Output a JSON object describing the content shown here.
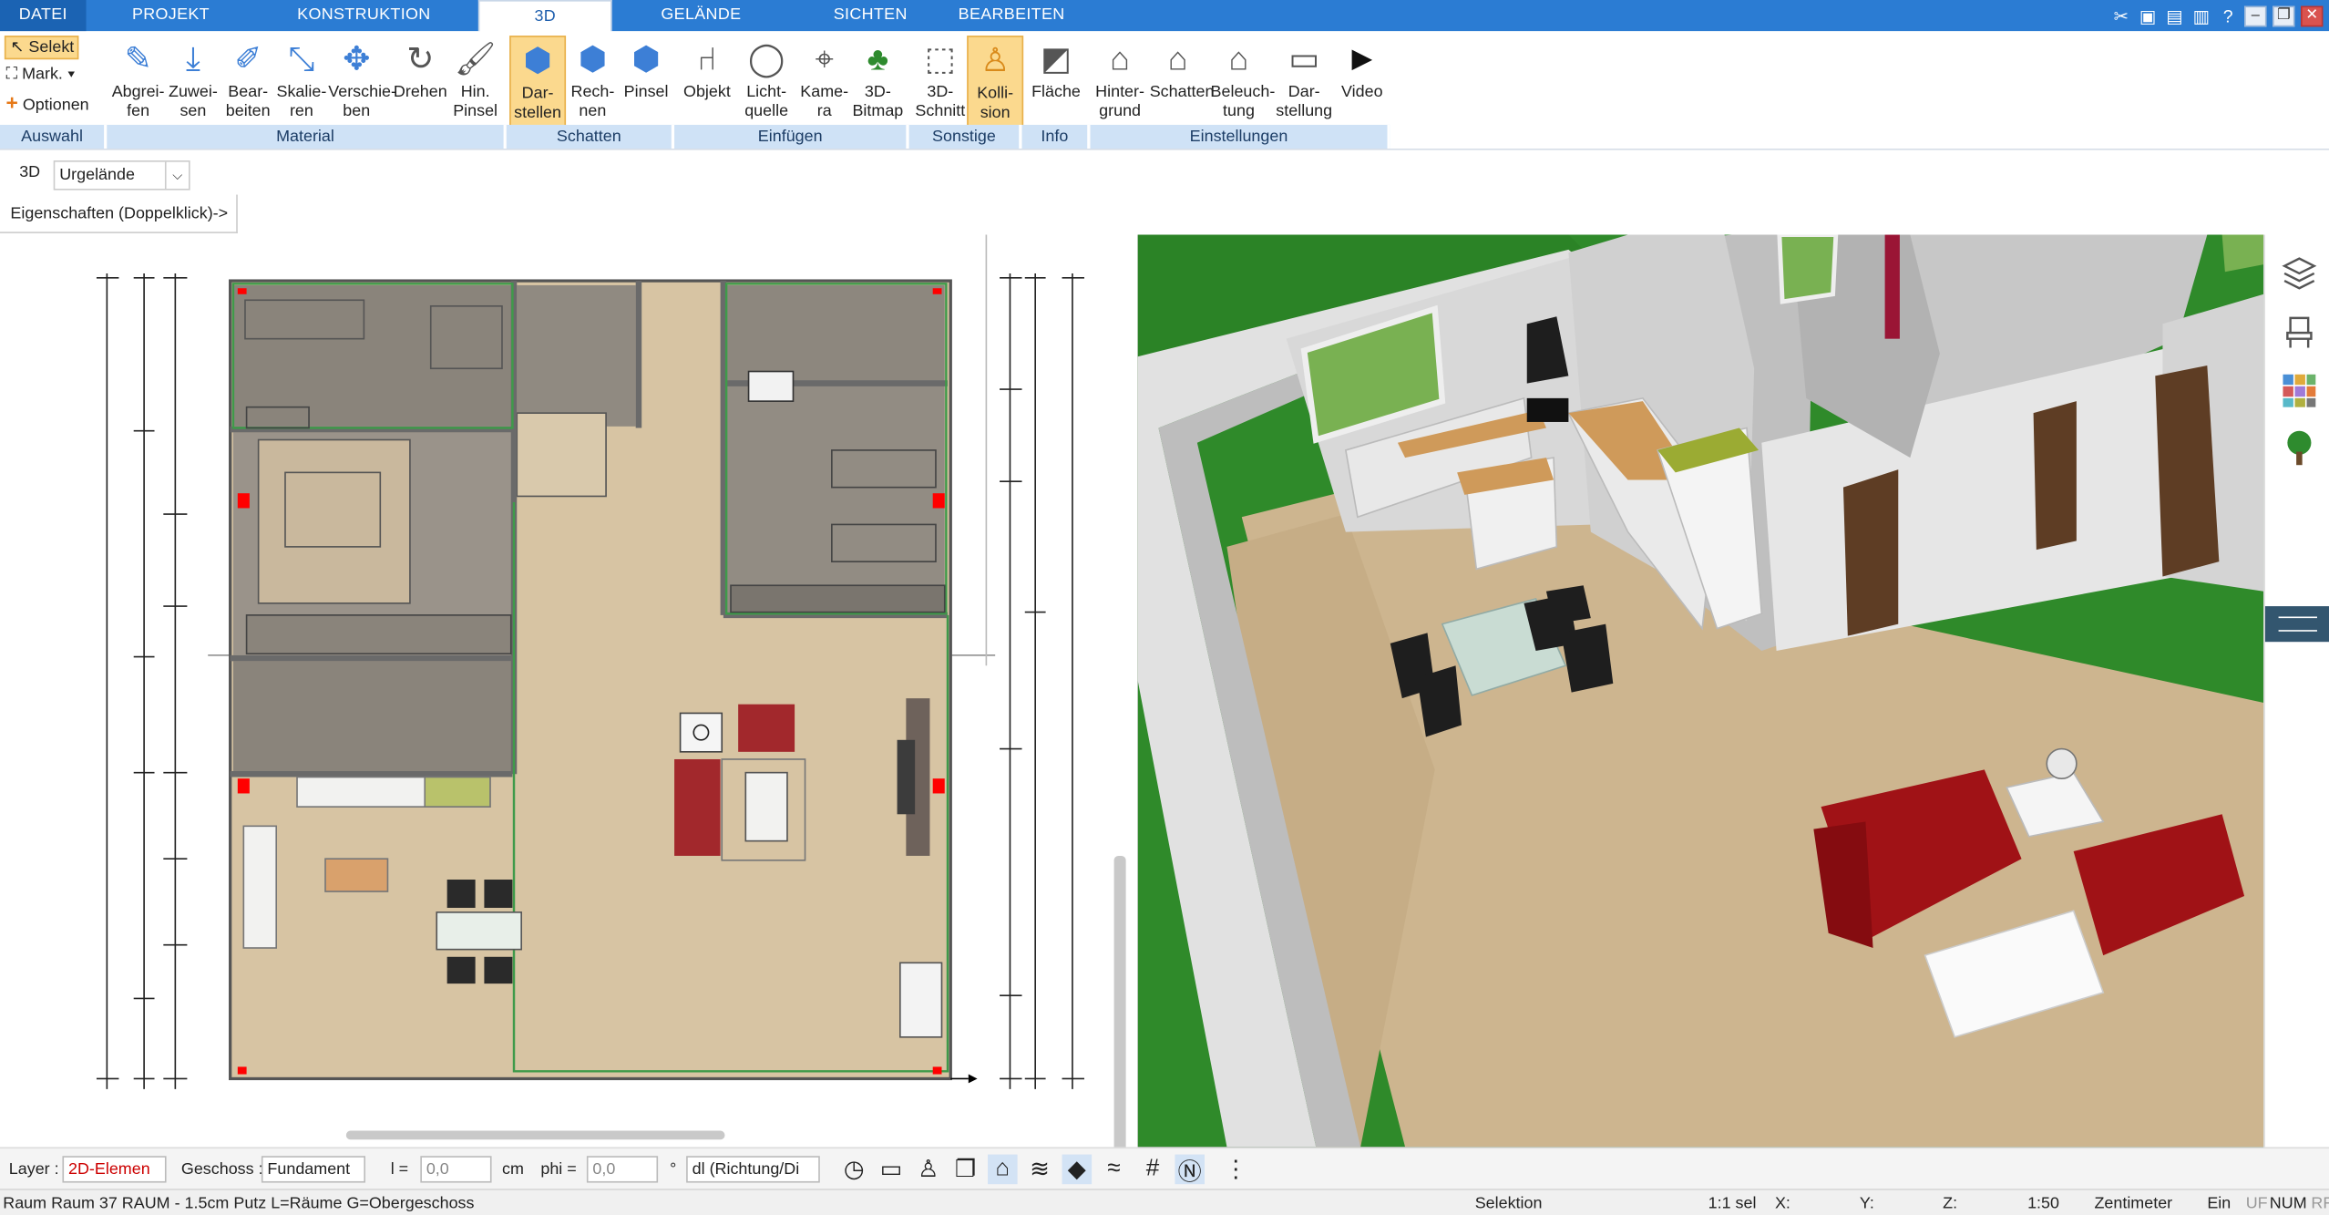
{
  "tabs": [
    {
      "label": "DATEI"
    },
    {
      "label": "PROJEKT"
    },
    {
      "label": "KONSTRUKTION"
    },
    {
      "label": "3D"
    },
    {
      "label": "GELÄNDE"
    },
    {
      "label": "SICHTEN"
    },
    {
      "label": "BEARBEITEN"
    }
  ],
  "ribbon": {
    "auswahl": {
      "select_label": "Selekt",
      "mark_label": "Mark.",
      "options_label": "Optionen",
      "group": "Auswahl"
    },
    "material": {
      "group": "Material",
      "buttons": [
        {
          "l1": "Abgrei-",
          "l2": "fen",
          "icon": "eyedropper-icon"
        },
        {
          "l1": "Zuwei-",
          "l2": "sen",
          "icon": "assign-icon"
        },
        {
          "l1": "Bear-",
          "l2": "beiten",
          "icon": "edit-material-icon"
        },
        {
          "l1": "Skalie-",
          "l2": "ren",
          "icon": "scale-icon"
        },
        {
          "l1": "Verschie-",
          "l2": "ben",
          "icon": "move-icon"
        },
        {
          "l1": "Drehen",
          "l2": "",
          "icon": "rotate-icon"
        },
        {
          "l1": "Hin.",
          "l2": "Pinsel",
          "icon": "brush-icon"
        }
      ]
    },
    "schatten": {
      "group": "Schatten",
      "buttons": [
        {
          "l1": "Dar-",
          "l2": "stellen",
          "icon": "cube-shadow-icon",
          "active": true
        },
        {
          "l1": "Rech-",
          "l2": "nen",
          "icon": "cube-calc-icon"
        },
        {
          "l1": "Pinsel",
          "l2": "",
          "icon": "cube-brush-icon"
        }
      ]
    },
    "einfuegen": {
      "group": "Einfügen",
      "buttons": [
        {
          "l1": "Objekt",
          "l2": "",
          "icon": "chair-icon"
        },
        {
          "l1": "Licht-",
          "l2": "quelle",
          "icon": "bulb-icon"
        },
        {
          "l1": "Kame-",
          "l2": "ra",
          "icon": "camera-icon"
        },
        {
          "l1": "3D-",
          "l2": "Bitmap",
          "icon": "tree-icon"
        }
      ]
    },
    "sonstige": {
      "group": "Sonstige",
      "buttons": [
        {
          "l1": "3D-",
          "l2": "Schnitt",
          "icon": "section-icon"
        },
        {
          "l1": "Kolli-",
          "l2": "sion",
          "icon": "collision-icon",
          "active": true
        }
      ]
    },
    "info": {
      "group": "Info",
      "buttons": [
        {
          "l1": "Fläche",
          "l2": "",
          "icon": "area-icon"
        }
      ]
    },
    "einstellungen": {
      "group": "Einstellungen",
      "buttons": [
        {
          "l1": "Hinter-",
          "l2": "grund",
          "icon": "house-bg-icon"
        },
        {
          "l1": "Schatten",
          "l2": "",
          "icon": "house-shadow-icon"
        },
        {
          "l1": "Beleuch-",
          "l2": "tung",
          "icon": "house-light-icon"
        },
        {
          "l1": "Dar-",
          "l2": "stellung",
          "icon": "monitor-icon"
        },
        {
          "l1": "Video",
          "l2": "",
          "icon": "play-icon"
        }
      ]
    }
  },
  "viewbar": {
    "mode": "3D",
    "terrain": "Urgelände"
  },
  "properties_hint": "Eigenschaften (Doppelklick)->",
  "bottom": {
    "layer_label": "Layer :",
    "layer_value": "2D-Elemen",
    "floor_label": "Geschoss :",
    "floor_value": "Fundament",
    "l_label": "l =",
    "l_value": "0,0",
    "l_unit": "cm",
    "phi_label": "phi =",
    "phi_value": "0,0",
    "phi_unit": "°",
    "dl_value": "dl (Richtung/Di"
  },
  "status": {
    "left": "Raum Raum 37 RAUM - 1.5cm Putz L=Räume G=Obergeschoss",
    "mode": "Selektion",
    "sel": "1:1 sel",
    "x": "X:",
    "y": "Y:",
    "z": "Z:",
    "scale": "1:50",
    "unit": "Zentimeter",
    "ein": "Ein",
    "uf": "UF",
    "num": "NUM",
    "rf": "RF"
  },
  "colors": {
    "accent": "#2b7cd3",
    "active_btn": "#fbd98e",
    "group_bar": "#cfe2f6",
    "grass": "#2f8a2a",
    "floor": "#cdb58f",
    "sofa": "#a01216"
  }
}
